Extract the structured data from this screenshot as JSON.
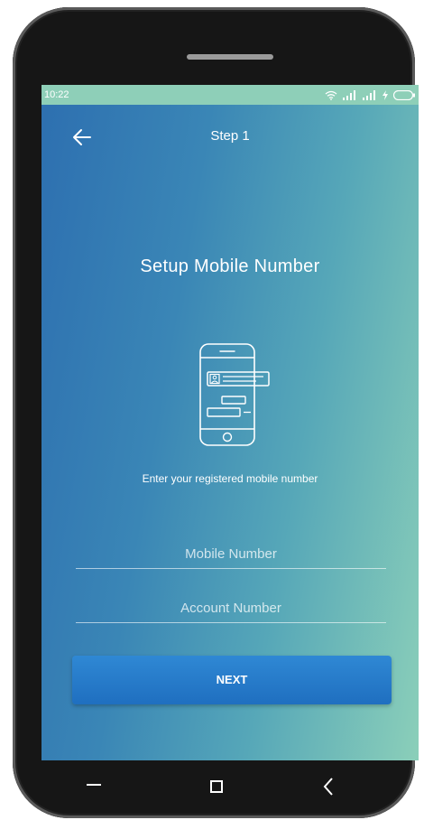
{
  "status_bar": {
    "time": "10:22",
    "icons": [
      "wifi-icon",
      "signal-icon",
      "signal-icon",
      "charging-icon",
      "battery-icon"
    ]
  },
  "app_bar": {
    "back_icon": "arrow-left-icon",
    "title": "Step 1"
  },
  "main": {
    "heading": "Setup Mobile Number",
    "illustration_icon": "phone-chat-icon",
    "instruction": "Enter your registered mobile number",
    "mobile_placeholder": "Mobile Number",
    "account_placeholder": "Account Number",
    "next_label": "NEXT"
  },
  "nav_bar": {
    "icons": [
      "menu-icon",
      "home-square-icon",
      "back-chevron-icon"
    ]
  },
  "colors": {
    "gradient_start": "#2d6fb0",
    "gradient_end": "#8bcfb9",
    "status_bar": "#8ecfb8",
    "button": "#1f6fc0",
    "text": "#ffffff"
  }
}
